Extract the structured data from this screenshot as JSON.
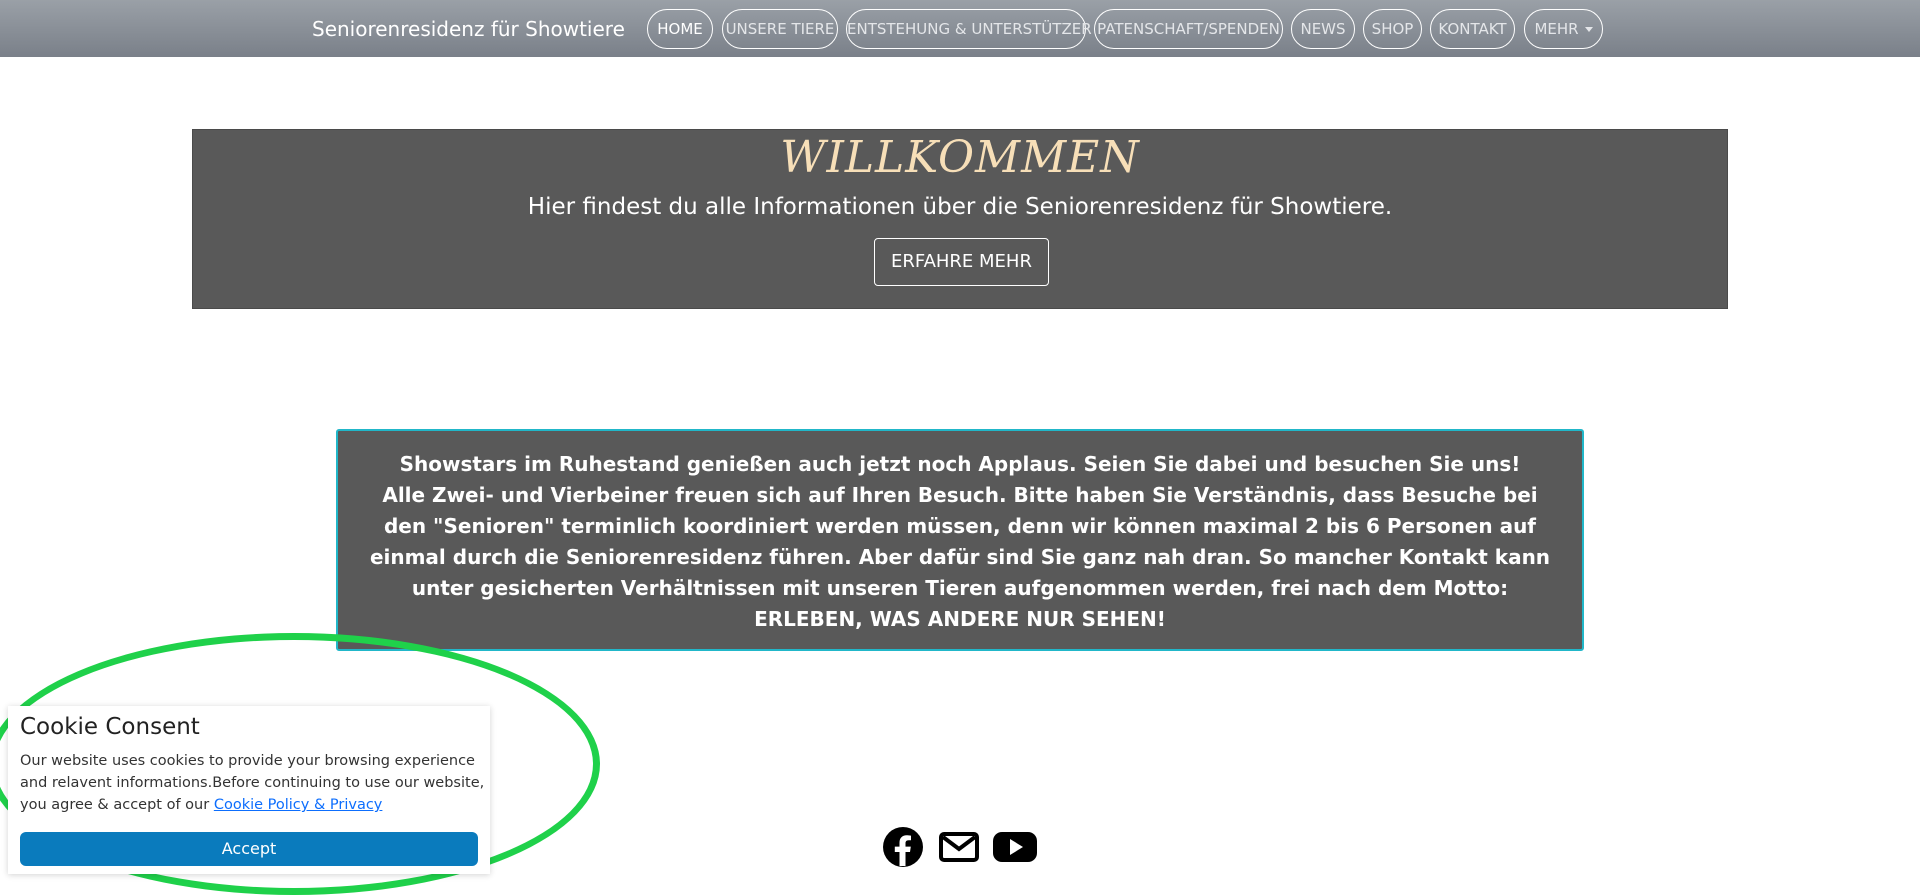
{
  "navbar": {
    "brand": "Seniorenresidenz für Showtiere",
    "items": [
      {
        "label": "HOME",
        "active": true
      },
      {
        "label": "UNSERE TIERE"
      },
      {
        "label": "ENTSTEHUNG & UNTERSTÜTZER"
      },
      {
        "label": "PATENSCHAFT/SPENDEN"
      },
      {
        "label": "NEWS"
      },
      {
        "label": "SHOP"
      },
      {
        "label": "KONTAKT"
      },
      {
        "label": "MEHR",
        "dropdown": true
      }
    ]
  },
  "hero": {
    "title": "WILLKOMMEN",
    "subtitle": "Hier findest du alle Informationen über die Seniorenresidenz für Showtiere.",
    "button": "ERFAHRE MEHR"
  },
  "info": {
    "line1_bold": "Showstars im Ruhestand",
    "line1_rest": " genießen auch jetzt noch Applaus. Seien Sie dabei und besuchen Sie uns!",
    "line2_bold": "Alle Zwei- und Vierbeiner",
    "line2_rest": " freuen sich auf Ihren Besuch. Bitte haben Sie Verständnis, dass Besuche bei den \"Senioren\" terminlich koordiniert werden müssen, denn wir können maximal 2 bis 6 Personen auf einmal durch die Seniorenresidenz führen. Aber dafür sind Sie ganz nah dran. So mancher Kontakt kann unter gesicherten Verhältnissen mit unseren Tieren aufgenommen werden, frei nach dem Motto:",
    "motto": "ERLEBEN, WAS ANDERE NUR SEHEN!"
  },
  "social": {
    "icons": [
      "facebook-icon",
      "mail-icon",
      "youtube-icon"
    ]
  },
  "cookie": {
    "title": "Cookie Consent",
    "text": "Our website uses cookies to provide your browsing experience and relavent informations.Before continuing to use our website, you agree & accept of our ",
    "link": "Cookie Policy & Privacy",
    "button": "Accept"
  },
  "colors": {
    "accent_title": "#f7dfb8",
    "panel_bg": "#595959",
    "info_border": "#21b7c9",
    "cookie_button": "#0a7bbd",
    "highlight_ellipse": "#1fd14a"
  }
}
